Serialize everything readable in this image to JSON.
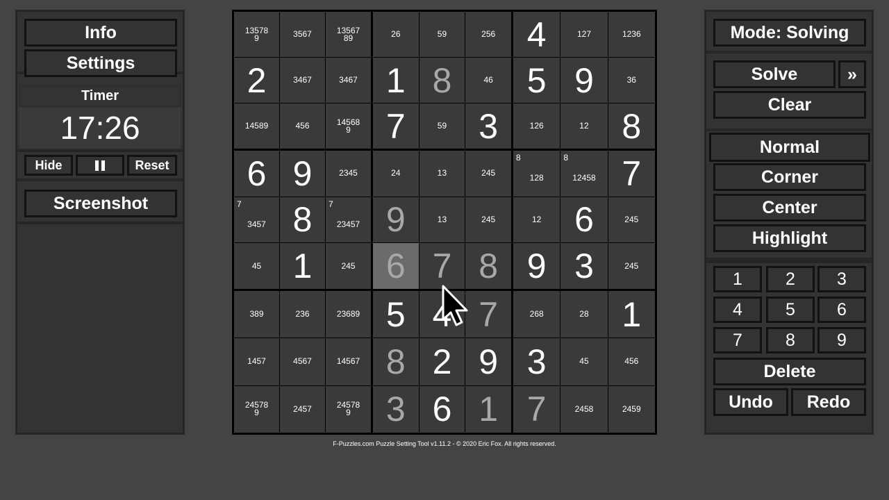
{
  "left": {
    "info": "Info",
    "settings": "Settings",
    "timer_label": "Timer",
    "timer_value": "17:26",
    "hide": "Hide",
    "reset": "Reset",
    "screenshot": "Screenshot"
  },
  "right": {
    "mode": "Mode: Solving",
    "solve": "Solve",
    "skip": "»",
    "clear": "Clear",
    "modes": [
      "Normal",
      "Corner",
      "Center",
      "Highlight"
    ],
    "digits": [
      "1",
      "2",
      "3",
      "4",
      "5",
      "6",
      "7",
      "8",
      "9"
    ],
    "delete": "Delete",
    "undo": "Undo",
    "redo": "Redo"
  },
  "footer": "F-Puzzles.com Puzzle Setting Tool v1.11.2 - © 2020 Eric Fox. All rights reserved.",
  "grid": [
    [
      {
        "p": "135789"
      },
      {
        "p": "3567"
      },
      {
        "p": "1356789"
      },
      {
        "p": "26"
      },
      {
        "p": "59"
      },
      {
        "p": "256"
      },
      {
        "v": "4",
        "k": "given"
      },
      {
        "p": "127"
      },
      {
        "p": "1236"
      }
    ],
    [
      {
        "v": "2",
        "k": "given"
      },
      {
        "p": "3467"
      },
      {
        "p": "3467"
      },
      {
        "v": "1",
        "k": "given"
      },
      {
        "v": "8",
        "k": "entered"
      },
      {
        "p": "46"
      },
      {
        "v": "5",
        "k": "given"
      },
      {
        "v": "9",
        "k": "given"
      },
      {
        "p": "36"
      }
    ],
    [
      {
        "p": "14589"
      },
      {
        "p": "456"
      },
      {
        "p": "145689"
      },
      {
        "v": "7",
        "k": "given"
      },
      {
        "p": "59"
      },
      {
        "v": "3",
        "k": "given"
      },
      {
        "p": "126"
      },
      {
        "p": "12"
      },
      {
        "v": "8",
        "k": "given"
      }
    ],
    [
      {
        "v": "6",
        "k": "given"
      },
      {
        "v": "9",
        "k": "given"
      },
      {
        "p": "2345"
      },
      {
        "p": "24"
      },
      {
        "p": "13"
      },
      {
        "p": "245"
      },
      {
        "c": "8",
        "p": "128"
      },
      {
        "c": "8",
        "p": "12458"
      },
      {
        "v": "7",
        "k": "given"
      }
    ],
    [
      {
        "c": "7",
        "p": "3457"
      },
      {
        "v": "8",
        "k": "given"
      },
      {
        "c": "7",
        "p": "23457"
      },
      {
        "v": "9",
        "k": "entered"
      },
      {
        "p": "13"
      },
      {
        "p": "245"
      },
      {
        "p": "12"
      },
      {
        "v": "6",
        "k": "given"
      },
      {
        "p": "245"
      }
    ],
    [
      {
        "p": "45"
      },
      {
        "v": "1",
        "k": "given"
      },
      {
        "p": "245"
      },
      {
        "v": "6",
        "k": "entered",
        "hl": true
      },
      {
        "v": "7",
        "k": "entered"
      },
      {
        "v": "8",
        "k": "entered"
      },
      {
        "v": "9",
        "k": "given"
      },
      {
        "v": "3",
        "k": "given"
      },
      {
        "p": "245"
      }
    ],
    [
      {
        "p": "389"
      },
      {
        "p": "236"
      },
      {
        "p": "23689"
      },
      {
        "v": "5",
        "k": "given"
      },
      {
        "v": "4",
        "k": "given"
      },
      {
        "v": "7",
        "k": "entered"
      },
      {
        "p": "268"
      },
      {
        "p": "28"
      },
      {
        "v": "1",
        "k": "given"
      }
    ],
    [
      {
        "p": "1457"
      },
      {
        "p": "4567"
      },
      {
        "p": "14567"
      },
      {
        "v": "8",
        "k": "entered"
      },
      {
        "v": "2",
        "k": "given"
      },
      {
        "v": "9",
        "k": "given"
      },
      {
        "v": "3",
        "k": "given"
      },
      {
        "p": "45"
      },
      {
        "p": "456"
      }
    ],
    [
      {
        "p": "245789"
      },
      {
        "p": "2457"
      },
      {
        "p": "245789"
      },
      {
        "v": "3",
        "k": "entered"
      },
      {
        "v": "6",
        "k": "given"
      },
      {
        "v": "1",
        "k": "entered"
      },
      {
        "v": "7",
        "k": "entered"
      },
      {
        "p": "2458"
      },
      {
        "p": "2459"
      }
    ]
  ]
}
